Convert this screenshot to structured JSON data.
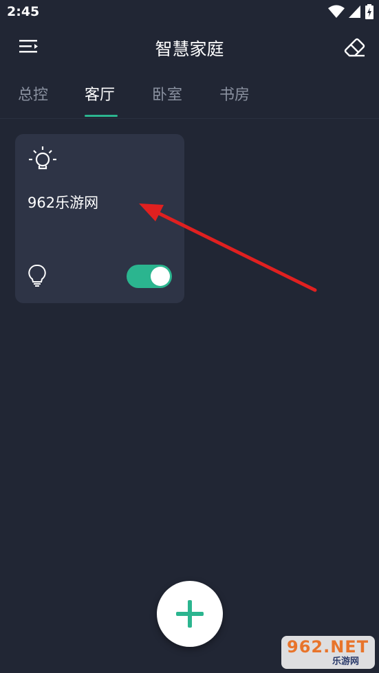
{
  "status_bar": {
    "time": "2:45",
    "icons": [
      "wifi-icon",
      "cell-signal-icon",
      "battery-charging-icon"
    ]
  },
  "app_bar": {
    "title": "智慧家庭",
    "left_icon": "menu-icon",
    "right_icon": "eraser-icon"
  },
  "tabs": [
    {
      "label": "总控",
      "active": false
    },
    {
      "label": "客厅",
      "active": true
    },
    {
      "label": "卧室",
      "active": false
    },
    {
      "label": "书房",
      "active": false
    }
  ],
  "device_card": {
    "name": "962乐游网",
    "icon": "light-bulb-icon",
    "switch_on": true
  },
  "fab": {
    "icon": "plus-icon"
  },
  "colors": {
    "background": "#212634",
    "card": "#2e3446",
    "accent": "#2bb58f",
    "arrow": "#e02020"
  },
  "watermark": {
    "main": "962.NET",
    "sub": "乐游网"
  }
}
